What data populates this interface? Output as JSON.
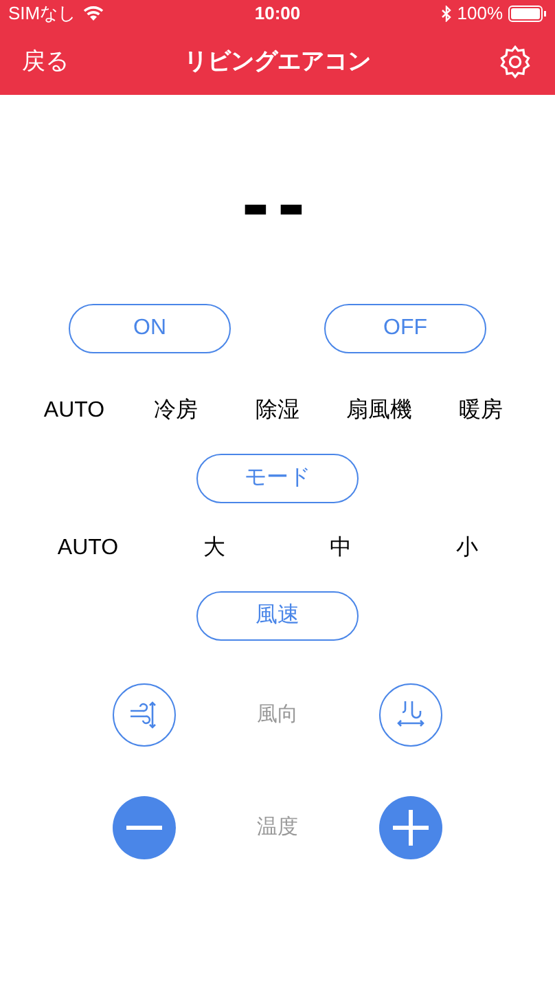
{
  "status_bar": {
    "carrier": "SIMなし",
    "time": "10:00",
    "battery": "100%"
  },
  "nav_bar": {
    "back": "戻る",
    "title": "リビングエアコン"
  },
  "display": "--",
  "power_buttons": [
    "ON",
    "OFF"
  ],
  "modes": [
    "AUTO",
    "冷房",
    "除湿",
    "扇風機",
    "暖房"
  ],
  "mode_button": "モード",
  "fan_speeds": [
    "AUTO",
    "大",
    "中",
    "小"
  ],
  "fan_button": "風速",
  "direction": {
    "label": "風向"
  },
  "temperature": {
    "label": "温度"
  }
}
